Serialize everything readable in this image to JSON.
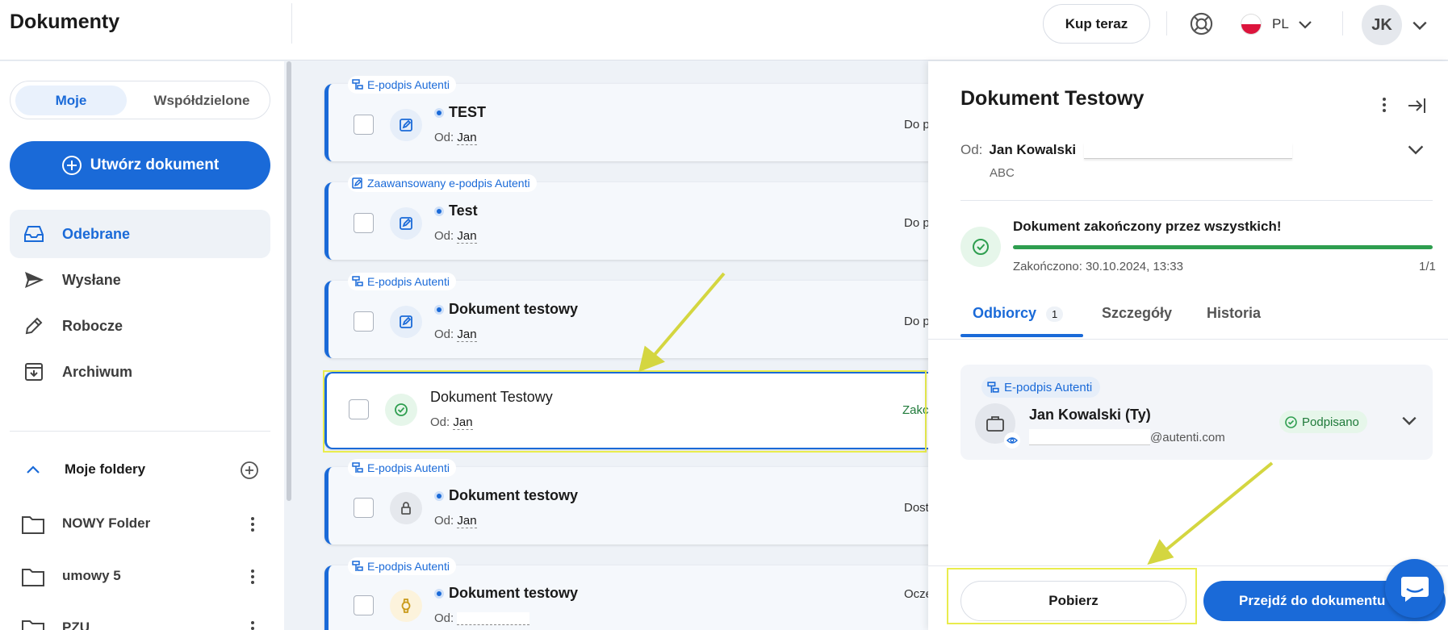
{
  "header": {
    "title": "Dokumenty",
    "buy_label": "Kup teraz",
    "lang_label": "PL",
    "avatar_initials": "JK"
  },
  "sidebar": {
    "segment": {
      "mine": "Moje",
      "shared": "Współdzielone"
    },
    "create_label": "Utwórz dokument",
    "nav": [
      {
        "label": "Odebrane",
        "icon": "inbox-icon"
      },
      {
        "label": "Wysłane",
        "icon": "send-icon"
      },
      {
        "label": "Robocze",
        "icon": "pencil-icon"
      },
      {
        "label": "Archiwum",
        "icon": "archive-icon"
      }
    ],
    "folders_title": "Moje foldery",
    "folders": [
      "NOWY Folder",
      "umowy 5",
      "PZU"
    ]
  },
  "documents": [
    {
      "tag": "E-podpis Autenti",
      "title": "TEST",
      "from_label": "Od:",
      "from": "Jan",
      "status": "Do p",
      "unread": true
    },
    {
      "tag": "Zaawansowany e-podpis Autenti",
      "title": "Test",
      "from_label": "Od:",
      "from": "Jan",
      "status": "Do p",
      "unread": true
    },
    {
      "tag": "E-podpis Autenti",
      "title": "Dokument testowy",
      "from_label": "Od:",
      "from": "Jan",
      "status": "Do p",
      "unread": true
    },
    {
      "tag": "",
      "title": "Dokument Testowy",
      "from_label": "Od:",
      "from": "Jan",
      "status": "Zakc",
      "unread": false
    },
    {
      "tag": "E-podpis Autenti",
      "title": "Dokument testowy",
      "from_label": "Od:",
      "from": "Jan",
      "status": "Dost",
      "unread": true
    },
    {
      "tag": "E-podpis Autenti",
      "title": "Dokument testowy",
      "from_label": "Od:",
      "from": "",
      "status": "Ocze",
      "unread": true
    }
  ],
  "panel": {
    "title": "Dokument Testowy",
    "from_label": "Od:",
    "from_name": "Jan Kowalski",
    "org": "ABC",
    "status_title": "Dokument zakończony przez wszystkich!",
    "progress": 1.0,
    "done_text": "Zakończono: 30.10.2024, 13:33",
    "done_count": "1/1",
    "tabs": [
      {
        "label": "Odbiorcy",
        "badge": "1"
      },
      {
        "label": "Szczegóły"
      },
      {
        "label": "Historia"
      }
    ],
    "recipient": {
      "tag": "E-podpis Autenti",
      "name": "Jan Kowalski (Ty)",
      "email_suffix": "@autenti.com",
      "status": "Podpisano"
    },
    "download_label": "Pobierz",
    "go_label": "Przejdź do dokumentu"
  },
  "colors": {
    "accent": "#1a6ad8",
    "success": "#2e9e4f",
    "annotation": "#e9ec4d"
  }
}
